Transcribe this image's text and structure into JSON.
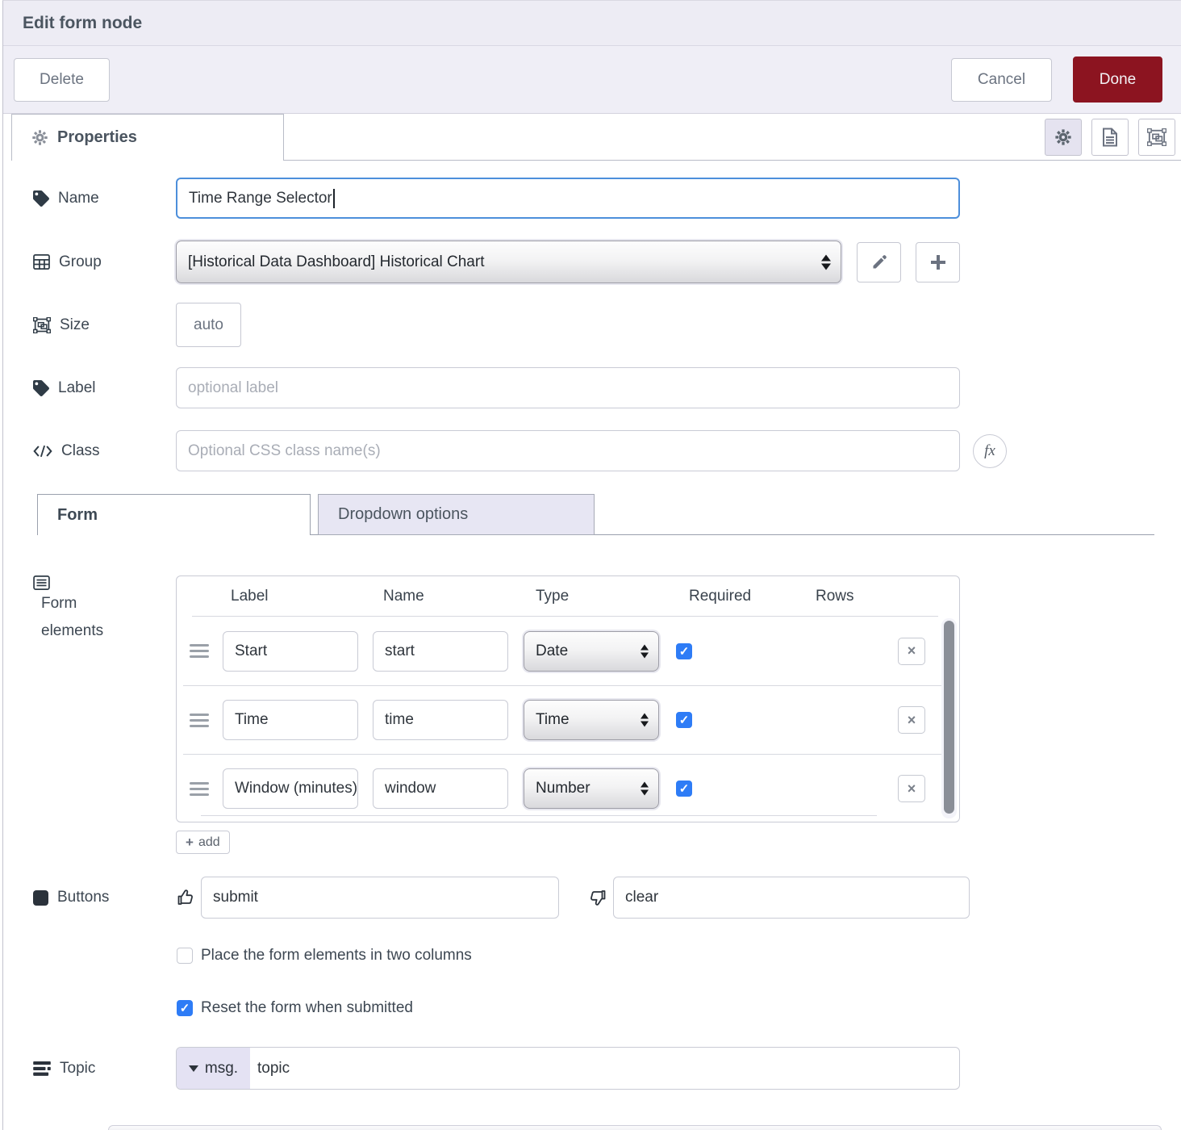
{
  "header": {
    "title": "Edit form node"
  },
  "toolbar": {
    "delete": "Delete",
    "cancel": "Cancel",
    "done": "Done"
  },
  "tabbar": {
    "properties": "Properties"
  },
  "fields": {
    "name": {
      "label": "Name",
      "value": "Time Range Selector"
    },
    "group": {
      "label": "Group",
      "value": "[Historical Data Dashboard] Historical Chart"
    },
    "size": {
      "label": "Size",
      "value": "auto"
    },
    "label": {
      "label": "Label",
      "placeholder": "optional label"
    },
    "class": {
      "label": "Class",
      "placeholder": "Optional CSS class name(s)",
      "fx_label": "fx"
    }
  },
  "section_tabs": {
    "form": "Form",
    "dropdown_options": "Dropdown options"
  },
  "form_elements": {
    "label": "Form elements",
    "columns": {
      "label": "Label",
      "name": "Name",
      "type": "Type",
      "required": "Required",
      "rows": "Rows"
    },
    "rows": [
      {
        "label": "Start",
        "name": "start",
        "type": "Date",
        "required": true
      },
      {
        "label": "Time",
        "name": "time",
        "type": "Time",
        "required": true
      },
      {
        "label": "Window (minutes)",
        "name": "window",
        "type": "Number",
        "required": true
      }
    ],
    "add_button": "add",
    "delete_glyph": "×"
  },
  "buttons_row": {
    "label": "Buttons",
    "submit_value": "submit",
    "clear_value": "clear"
  },
  "options": {
    "two_columns": {
      "label": "Place the form elements in two columns",
      "checked": false
    },
    "reset": {
      "label": "Reset the form when submitted",
      "checked": true
    }
  },
  "topic": {
    "label": "Topic",
    "prefix": "msg.",
    "value": "topic"
  },
  "colors": {
    "done_red": "#8c1420",
    "focus_blue": "#4d8fdb",
    "checkbox_blue": "#2e7cf6",
    "header_bg": "#edecf4"
  }
}
